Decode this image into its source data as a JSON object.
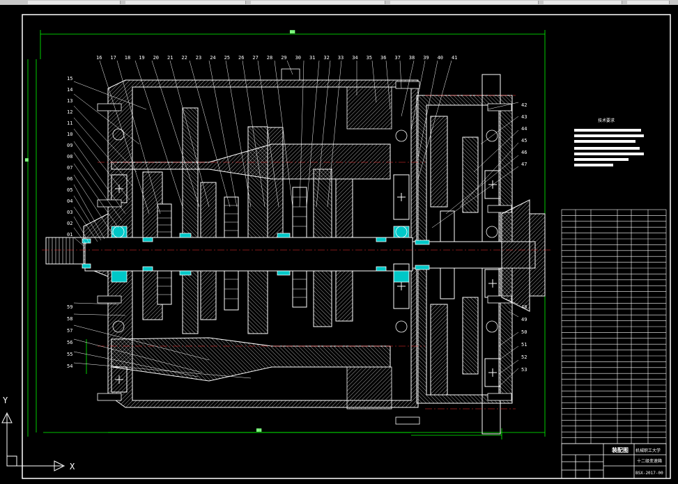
{
  "window": {
    "top_strip_segments": 6
  },
  "drawing": {
    "background": "#000000",
    "colors": {
      "outline": "#ffffff",
      "dimension": "#00ff00",
      "centerline": "#ff3030",
      "bearing_fill": "#00c8c8",
      "hatch": "#bdbdbd",
      "shaft": "#d8d8d8"
    },
    "part_callouts_top": [
      "16",
      "17",
      "18",
      "19",
      "20",
      "21",
      "22",
      "23",
      "24",
      "25",
      "26",
      "27",
      "28",
      "29",
      "30",
      "31",
      "32",
      "33",
      "34",
      "35",
      "36",
      "37",
      "38",
      "39",
      "40",
      "41"
    ],
    "part_callouts_left": [
      "15",
      "14",
      "13",
      "12",
      "11",
      "10",
      "09",
      "08",
      "07",
      "06",
      "05",
      "04",
      "03",
      "02",
      "01"
    ],
    "part_callouts_right": [
      "42",
      "43",
      "44",
      "45",
      "46",
      "47",
      "48",
      "49",
      "50",
      "51",
      "52",
      "53"
    ],
    "part_callouts_bottom_left": [
      "59",
      "58",
      "57",
      "56",
      "55",
      "54"
    ],
    "tech_requirements_title": "技术要求",
    "ucs": {
      "x_label": "X",
      "y_label": "Y"
    },
    "title_block": {
      "drawing_name": "装配图",
      "school": "机械职工大学",
      "product": "十二级变速箱",
      "number": "BSX-2017-00"
    },
    "parts_list_rows": 40
  }
}
